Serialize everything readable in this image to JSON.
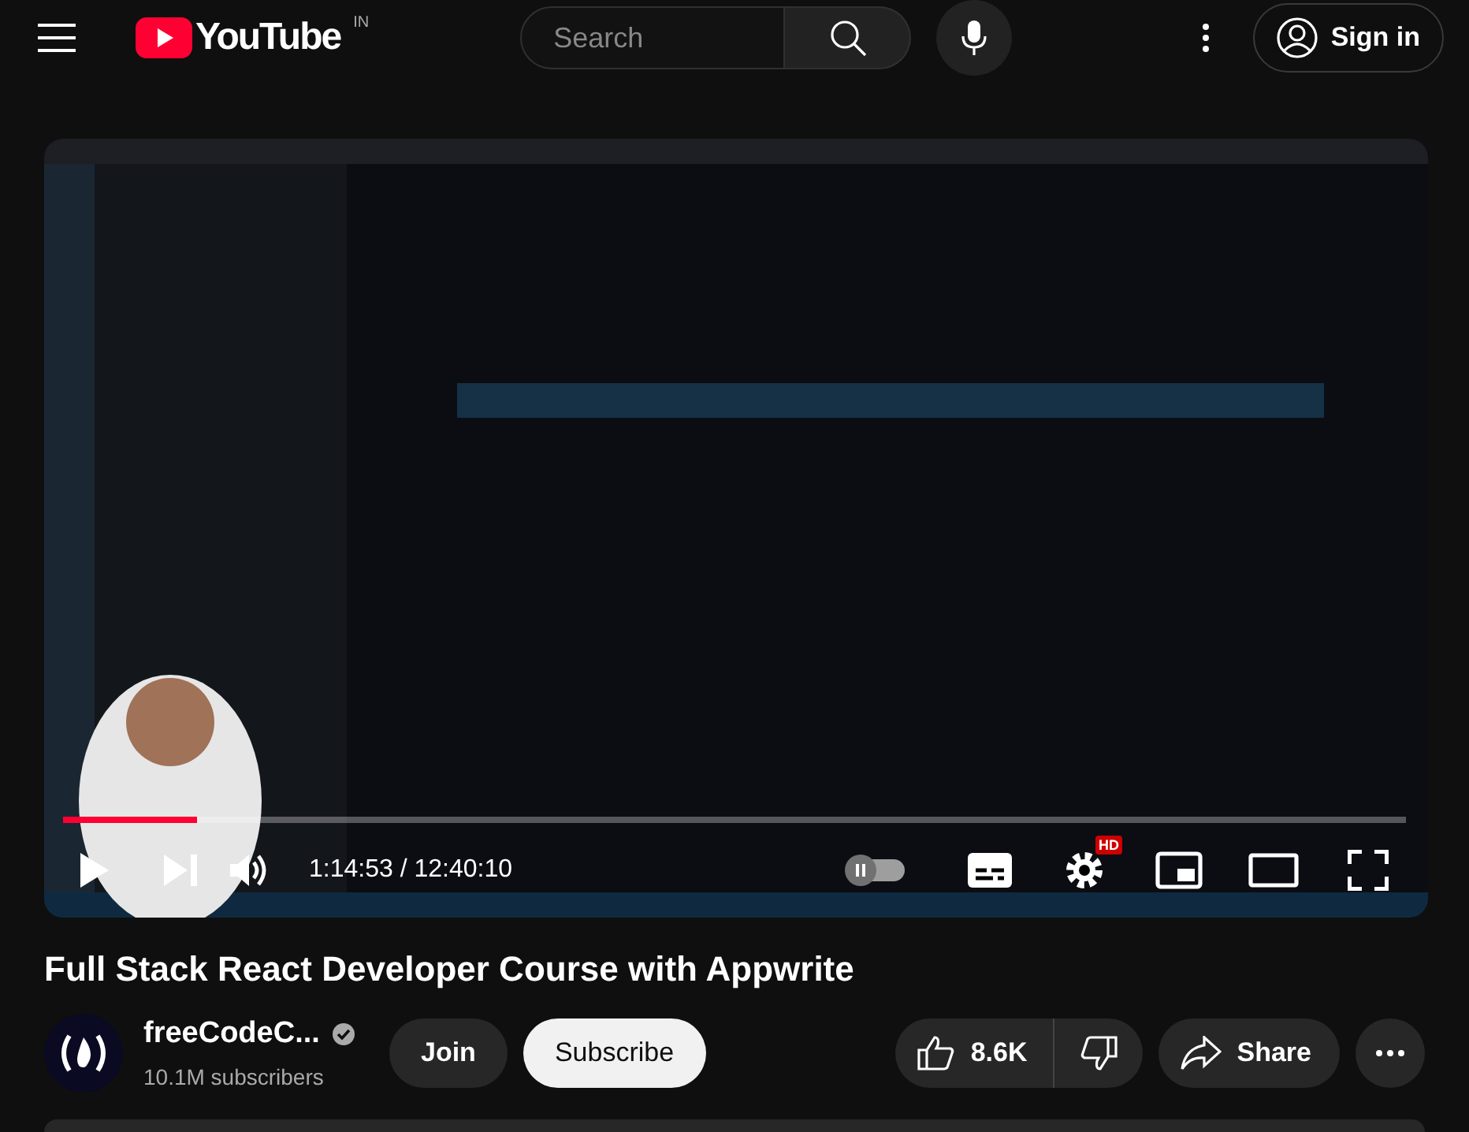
{
  "header": {
    "logo_text": "YouTube",
    "region": "IN",
    "search": {
      "placeholder": "Search"
    },
    "sign_in": "Sign in"
  },
  "player": {
    "kind": "picture",
    "progress": {
      "level": 0.1
    },
    "playing": false,
    "time": "1:14:53 / 12:40:10",
    "autoplay": {
      "on": false
    },
    "quality_badge": "HD"
  },
  "video": {
    "title": "Full Stack React Developer Course with Appwrite",
    "channel": {
      "name": "freeCodeC...",
      "verified": true,
      "subscribers": "10.1M subscribers"
    },
    "join": "Join",
    "subscribe": "Subscribe",
    "likes": "8.6K",
    "share": "Share"
  }
}
